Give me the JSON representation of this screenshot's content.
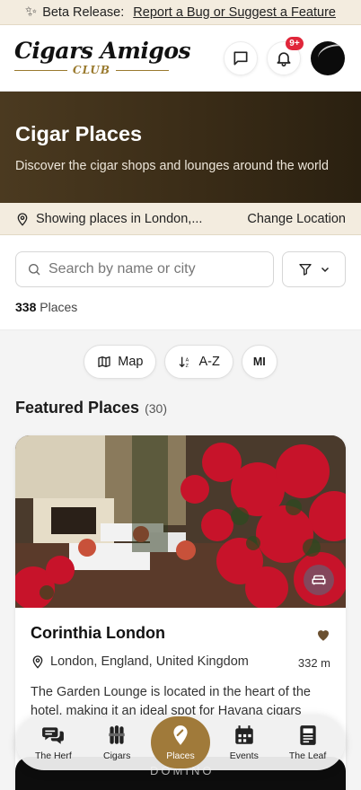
{
  "beta_banner": {
    "prefix": "Beta Release:",
    "link": "Report a Bug or Suggest a Feature"
  },
  "header": {
    "logo_main": "Cigars Amigos",
    "logo_sub": "CLUB",
    "notification_badge": "9+"
  },
  "hero": {
    "title": "Cigar Places",
    "subtitle": "Discover the cigar shops and lounges around the world"
  },
  "location": {
    "text": "Showing places in London,...",
    "change_label": "Change Location"
  },
  "search": {
    "placeholder": "Search by name or city"
  },
  "results": {
    "count": "338",
    "label": "Places"
  },
  "pills": {
    "map": "Map",
    "sort": "A-Z",
    "units": "MI"
  },
  "featured": {
    "title": "Featured Places",
    "count": "(30)"
  },
  "places": [
    {
      "name": "Corinthia London",
      "location": "London, England, United Kingdom",
      "distance": "332 m",
      "description": "The Garden Lounge is located in the heart of the hotel, making it an ideal spot for Havana cigars"
    }
  ],
  "next_card_text": "DOMINO",
  "bottom_nav": [
    {
      "label": "The Herf",
      "icon": "chat-bubbles-icon"
    },
    {
      "label": "Cigars",
      "icon": "cigars-icon"
    },
    {
      "label": "Places",
      "icon": "map-pin-icon",
      "active": true
    },
    {
      "label": "Events",
      "icon": "calendar-icon"
    },
    {
      "label": "The Leaf",
      "icon": "newspaper-icon"
    }
  ],
  "colors": {
    "accent": "#a07a3a",
    "hero_bg": "#3a2c17",
    "banner_bg": "#f3ecdf",
    "badge": "#e0263a"
  }
}
